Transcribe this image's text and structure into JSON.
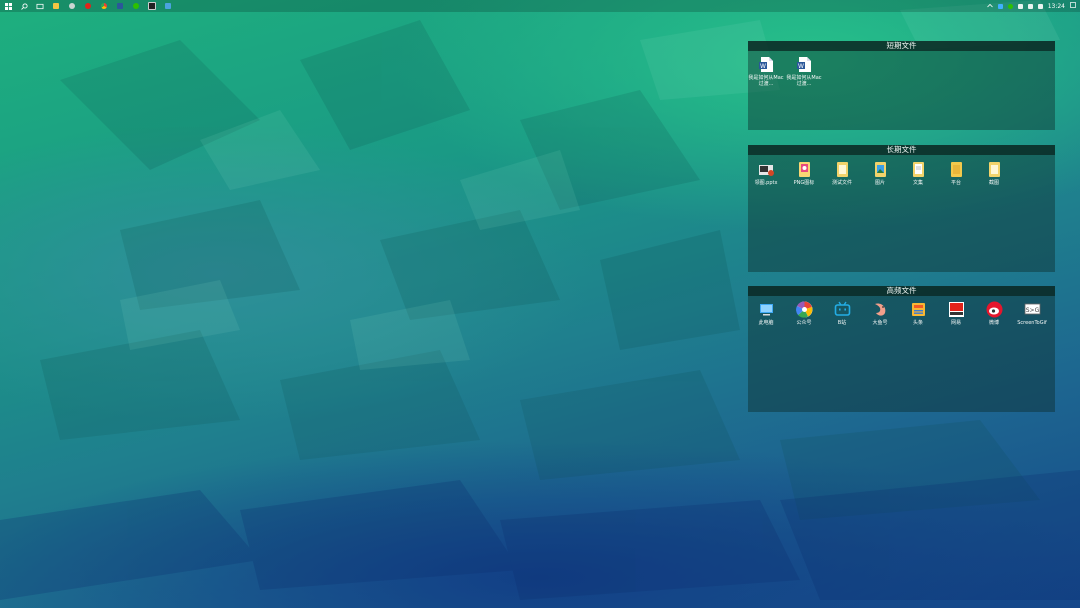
{
  "taskbar": {
    "icons": [
      "windows-start-icon",
      "search-icon",
      "task-view-icon",
      "file-explorer-icon",
      "settings-icon",
      "netease-music-icon",
      "chrome-icon",
      "word-icon",
      "wechat-icon",
      "terminal-icon",
      "app-icon"
    ],
    "tray_time": "13:24"
  },
  "fences": [
    {
      "title": "短期文件",
      "items": [
        {
          "icon": "word-document-icon",
          "label": "我是如何从Mac过渡..."
        },
        {
          "icon": "word-document-icon",
          "label": "我是如何从Mac过渡..."
        }
      ]
    },
    {
      "title": "长期文件",
      "items": [
        {
          "icon": "pptx-file-icon",
          "label": "领图.pptx"
        },
        {
          "icon": "png-icons-folder-icon",
          "label": "PNG图标"
        },
        {
          "icon": "folder-icon",
          "label": "测试文件"
        },
        {
          "icon": "pictures-folder-icon",
          "label": "图片"
        },
        {
          "icon": "documents-folder-icon",
          "label": "文集"
        },
        {
          "icon": "folder-icon",
          "label": "平台"
        },
        {
          "icon": "folder-icon",
          "label": "截图"
        }
      ]
    },
    {
      "title": "高频文件",
      "items": [
        {
          "icon": "this-pc-icon",
          "label": "此电脑"
        },
        {
          "icon": "wechat-public-icon",
          "label": "公众号"
        },
        {
          "icon": "bilibili-icon",
          "label": "B站"
        },
        {
          "icon": "dayu-icon",
          "label": "大鱼号"
        },
        {
          "icon": "toutiao-icon",
          "label": "头条"
        },
        {
          "icon": "netease-icon",
          "label": "网易"
        },
        {
          "icon": "weibo-icon",
          "label": "微博"
        },
        {
          "icon": "screentogif-icon",
          "label": "ScreenToGif"
        }
      ]
    }
  ],
  "colors": {
    "accent": "#2196f3",
    "fence_bg": "#0c2826",
    "title_bar": "#0a2620"
  }
}
